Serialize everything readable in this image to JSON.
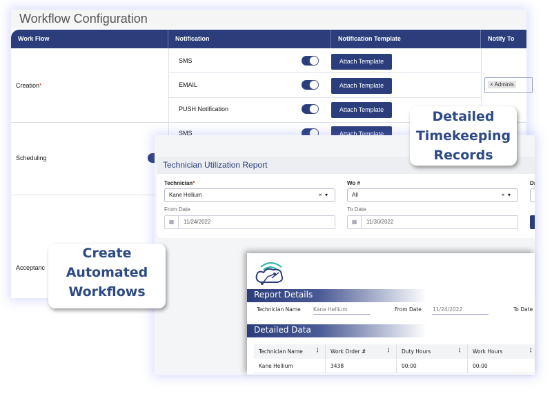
{
  "workflow": {
    "title": "Workflow Configuration",
    "headers": [
      "Work Flow",
      "Notification",
      "Notification Template",
      "Notify To"
    ],
    "rows": [
      {
        "workflow": "Creation",
        "required": "*",
        "notification": "SMS",
        "enabled": true,
        "button": "Attach Template"
      },
      {
        "notification": "EMAIL",
        "enabled": true,
        "button": "Attach Template"
      },
      {
        "notification": "PUSH Notification",
        "enabled": true,
        "button": "Attach Template"
      },
      {
        "workflow": "Scheduling",
        "notification": "SMS",
        "enabled": true,
        "button": "Attach Template"
      },
      {
        "workflow": "Acceptanc"
      }
    ],
    "notify_to_tag": "Adminis",
    "tag_remove": "×"
  },
  "report": {
    "title": "Technician Utilization Report",
    "technician_label": "Technician",
    "required": "*",
    "technician_value": "Kane Hellium",
    "wo_label": "Wo #",
    "wo_value": "All",
    "third_label": "Da",
    "clear": "×",
    "caret": "▾",
    "from_label": "From Date",
    "from_value": "11/24/2022",
    "to_label": "To Date",
    "to_value": "11/30/2022"
  },
  "printout": {
    "report_details": "Report Details",
    "tech_name_label": "Technician Name",
    "tech_name_value": "Kane Hellium",
    "from_label": "From Date",
    "from_value": "11/24/2022",
    "to_label": "To Date",
    "detailed_data": "Detailed Data",
    "columns": [
      "Technician Name",
      "Work Order #",
      "Duty Hours",
      "Work Hours"
    ],
    "rows": [
      [
        "Kane Hellium",
        "3438",
        "00:00",
        "00:00"
      ]
    ]
  },
  "callouts": {
    "timekeeping": [
      "Detailed",
      "Timekeeping",
      "Records"
    ],
    "workflows": [
      "Create",
      "Automated",
      "Workflows"
    ]
  },
  "colors": {
    "navy": "#2b3d7a",
    "callout_text": "#2d4a85",
    "required": "#dd2222"
  }
}
